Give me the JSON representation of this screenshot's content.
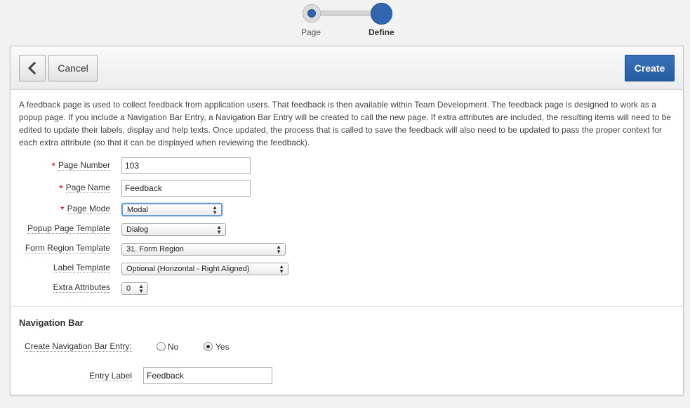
{
  "wizard": {
    "steps": [
      {
        "label": "Page"
      },
      {
        "label": "Define"
      }
    ]
  },
  "toolbar": {
    "back_icon": "chevron-left-icon",
    "cancel_label": "Cancel",
    "create_label": "Create"
  },
  "description": "A feedback page is used to collect feedback from application users. That feedback is then available within Team Development. The feedback page is designed to work as a popup page. If you include a Navigation Bar Entry, a Navigation Bar Entry will be created to call the new page. If extra attributes are included, the resulting items will need to be edited to update their labels, display and help texts. Once updated, the process that is called to save the feedback will also need to be updated to pass the proper context for each extra attribute (so that it can be displayed when reviewing the feedback).",
  "form": {
    "page_number": {
      "label": "Page Number",
      "value": "103",
      "required": true
    },
    "page_name": {
      "label": "Page Name",
      "value": "Feedback",
      "required": true
    },
    "page_mode": {
      "label": "Page Mode",
      "value": "Modal",
      "required": true
    },
    "popup_template": {
      "label": "Popup Page Template",
      "value": "Dialog"
    },
    "form_region_template": {
      "label": "Form Region Template",
      "value": "31. Form Region"
    },
    "label_template": {
      "label": "Label Template",
      "value": "Optional (Horizontal - Right Aligned)"
    },
    "extra_attributes": {
      "label": "Extra Attributes",
      "value": "0"
    }
  },
  "navigation_bar": {
    "title": "Navigation Bar",
    "create_entry_label": "Create Navigation Bar Entry:",
    "options": [
      "No",
      "Yes"
    ],
    "selected": "Yes",
    "entry_label": {
      "label": "Entry Label",
      "value": "Feedback"
    }
  },
  "colors": {
    "accent": "#2f66ae",
    "required": "#cc0000",
    "create_button": "#2a61a8"
  }
}
